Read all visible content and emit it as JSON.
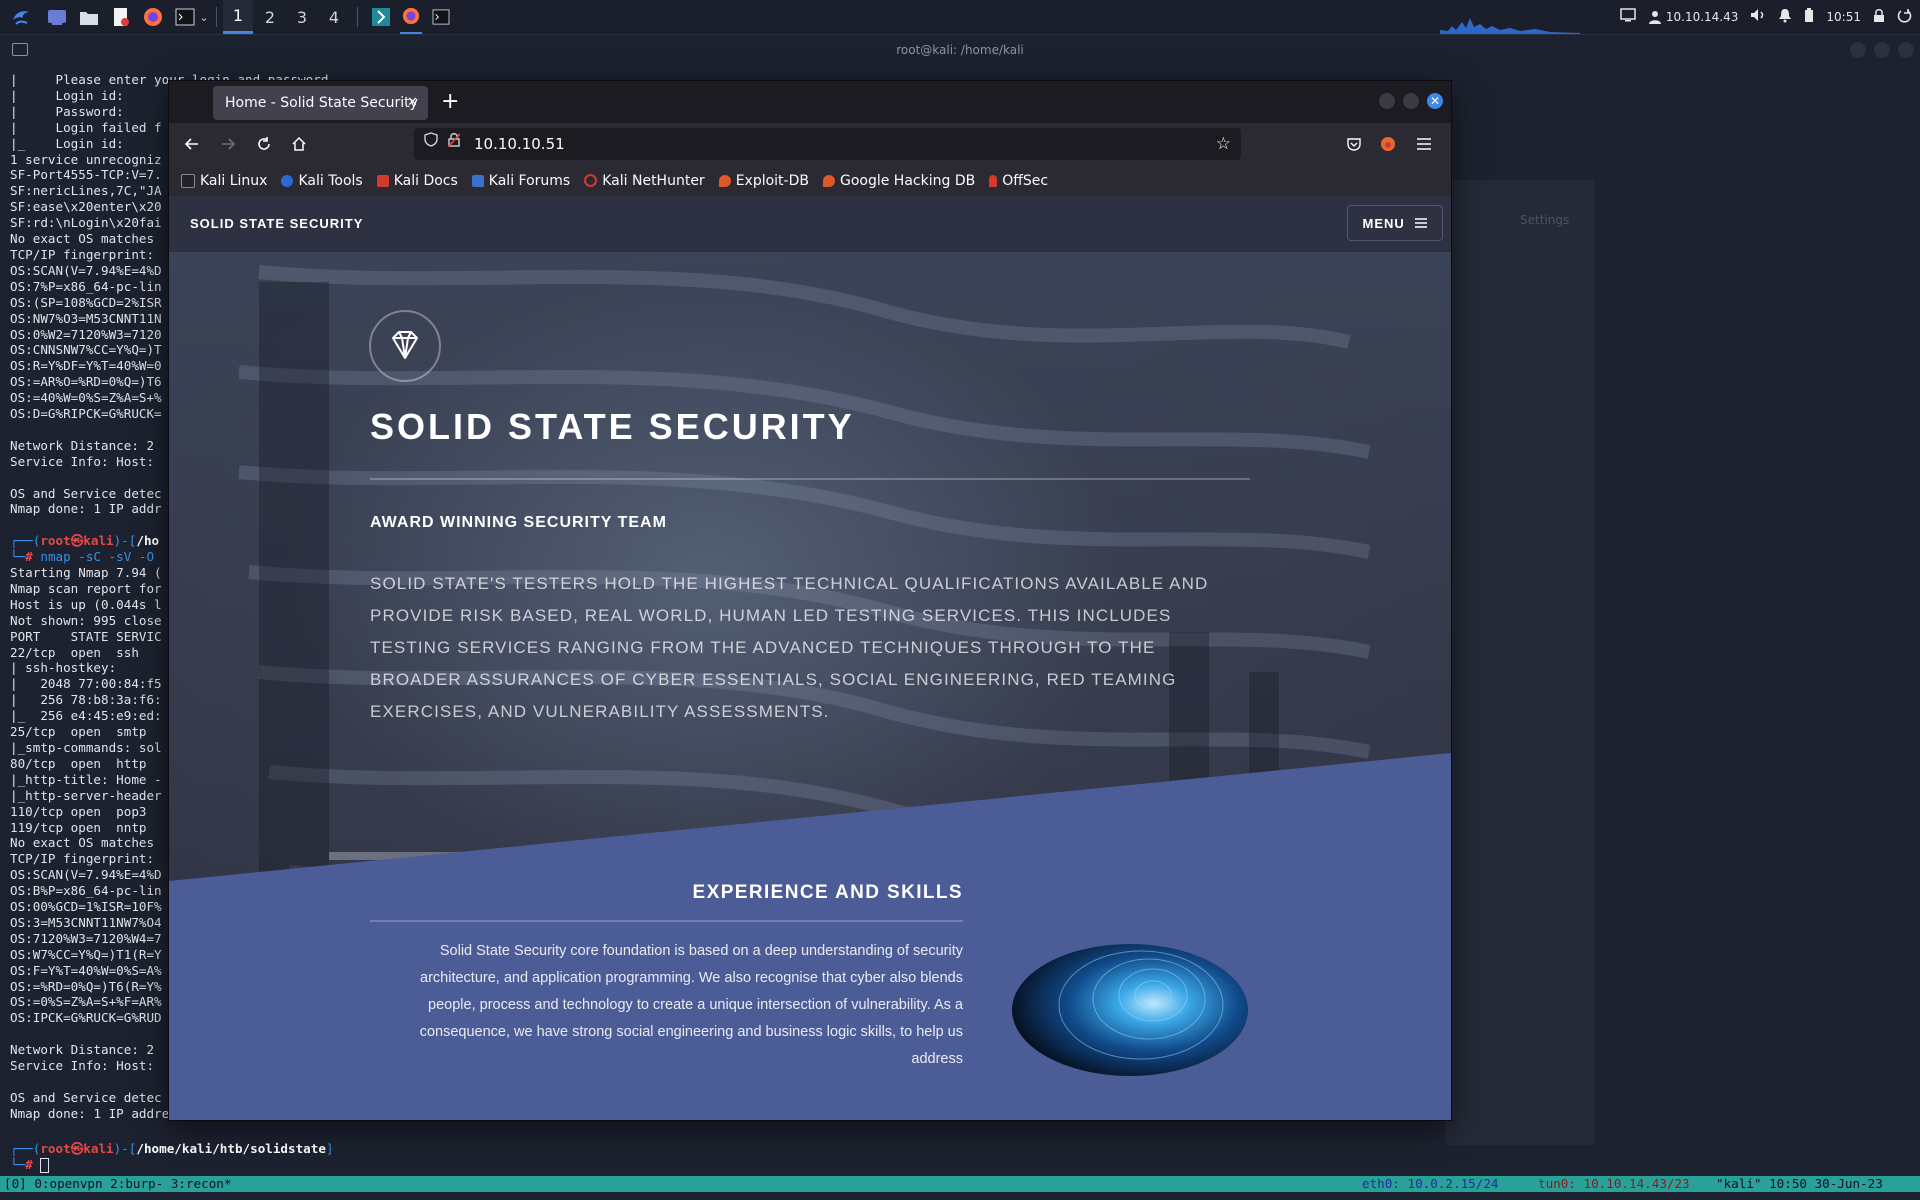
{
  "taskbar": {
    "workspaces": [
      "1",
      "2",
      "3",
      "4"
    ],
    "active_workspace": "1",
    "ip": "10.10.14.43",
    "clock": "10:51"
  },
  "terminal": {
    "title": "root@kali: /home/kali",
    "lines_top": "|     Please enter your login and password\n|     Login id:\n|     Password:\n|     Login failed f\n|_    Login id:\n1 service unrecogniz\nSF-Port4555-TCP:V=7.\nSF:nericLines,7C,\"JA\nSF:ease\\x20enter\\x20\nSF:rd:\\nLogin\\x20fai\nNo exact OS matches\nTCP/IP fingerprint:\nOS:SCAN(V=7.94%E=4%D\nOS:7%P=x86_64-pc-lin\nOS:(SP=108%GCD=2%ISR\nOS:NW7%O3=M53CNNT11N\nOS:0%W2=7120%W3=7120\nOS:CNNSNW7%CC=Y%Q=)T\nOS:R=Y%DF=Y%T=40%W=0\nOS:=AR%O=%RD=0%Q=)T6\nOS:=40%W=0%S=Z%A=S+%\nOS:D=G%RIPCK=G%RUCK=\n\nNetwork Distance: 2\nService Info: Host:\n\nOS and Service detec\nNmap done: 1 IP addr\n",
    "prompt1_user": "root",
    "prompt1_host": "kali",
    "prompt1_path": "/ho",
    "command": "nmap -sC -sV -O",
    "lines_bottom": "Starting Nmap 7.94 (\nNmap scan report for\nHost is up (0.044s l\nNot shown: 995 close\nPORT    STATE SERVIC\n22/tcp  open  ssh\n| ssh-hostkey:\n|   2048 77:00:84:f5\n|   256 78:b8:3a:f6:\n|_  256 e4:45:e9:ed:\n25/tcp  open  smtp\n|_smtp-commands: sol\n80/tcp  open  http\n|_http-title: Home -\n|_http-server-header\n110/tcp open  pop3\n119/tcp open  nntp\nNo exact OS matches\nTCP/IP fingerprint:\nOS:SCAN(V=7.94%E=4%D\nOS:B%P=x86_64-pc-lin\nOS:00%GCD=1%ISR=10F%\nOS:3=M53CNNT11NW7%O4\nOS:7120%W3=7120%W4=7\nOS:W7%CC=Y%Q=)T1(R=Y\nOS:F=Y%T=40%W=0%S=A%\nOS:=%RD=0%Q=)T6(R=Y%\nOS:=0%S=Z%A=S+%F=AR%\nOS:IPCK=G%RUCK=G%RUD\n\nNetwork Distance: 2\nService Info: Host:\n\nOS and Service detec\nNmap done: 1 IP address",
    "prompt2_user": "root",
    "prompt2_host": "kali",
    "prompt2_path": "/home/kali/htb/solidstate",
    "status_left": "[0] 0:openvpn  2:burp- 3:recon*",
    "status_eth": "eth0: 10.0.2.15/24",
    "status_tun": "tun0: 10.10.14.43/23",
    "status_right": "\"kali\" 10:50 30-Jun-23",
    "ghost_settings": "Settings"
  },
  "browser": {
    "tab_title": "Home - Solid State Security",
    "url": "10.10.10.51",
    "bookmarks": [
      {
        "label": "Kali Linux",
        "color": "#2a6bd1"
      },
      {
        "label": "Kali Tools",
        "color": "#2a6bd1"
      },
      {
        "label": "Kali Docs",
        "color": "#d33a2c"
      },
      {
        "label": "Kali Forums",
        "color": "#3a72c8"
      },
      {
        "label": "Kali NetHunter",
        "color": "#d33a2c"
      },
      {
        "label": "Exploit-DB",
        "color": "#e0582a"
      },
      {
        "label": "Google Hacking DB",
        "color": "#e0582a"
      },
      {
        "label": "OffSec",
        "color": "#d33a2c"
      }
    ]
  },
  "site": {
    "logo": "SOLID STATE SECURITY",
    "menu_label": "MENU",
    "hero_title": "SOLID STATE SECURITY",
    "hero_subtitle": "AWARD WINNING SECURITY TEAM",
    "hero_description": "SOLID STATE'S TESTERS HOLD THE HIGHEST TECHNICAL QUALIFICATIONS AVAILABLE AND PROVIDE RISK BASED, REAL WORLD, HUMAN LED TESTING SERVICES. THIS INCLUDES TESTING SERVICES RANGING FROM THE ADVANCED TECHNIQUES THROUGH TO THE BROADER ASSURANCES OF CYBER ESSENTIALS, SOCIAL ENGINEERING, RED TEAMING EXERCISES, AND VULNERABILITY ASSESSMENTS.",
    "section_title": "EXPERIENCE AND SKILLS",
    "section_text": "Solid State Security core foundation is based on a deep understanding of security architecture, and application programming. We also recognise that cyber also blends people, process and technology to create a unique intersection of vulnerability. As a consequence, we have strong social engineering and business logic skills, to help us address",
    "band_color": "#4c5c96"
  }
}
